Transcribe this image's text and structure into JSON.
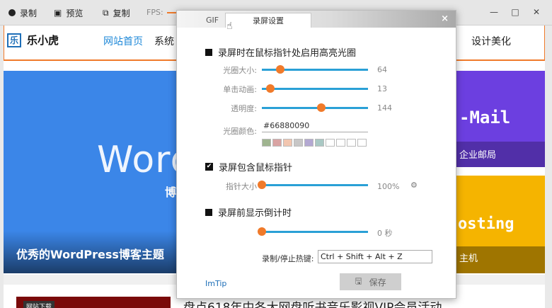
{
  "recorder": {
    "record_label": "录制",
    "preview_label": "预览",
    "copy_label": "复制",
    "fps_label": "FPS:"
  },
  "site": {
    "logo_mark": "乐",
    "logo_text": "乐小虎",
    "nav": [
      "网站首页",
      "系统",
      "设计美化"
    ],
    "hero": {
      "big_text": "Word",
      "sub_text": "博",
      "caption": "优秀的WordPress博客主题"
    },
    "card_purple": {
      "title": "-Mail",
      "subtitle": "企业邮局"
    },
    "card_yellow": {
      "title": "osting",
      "subtitle": "主机"
    },
    "article_tag": "网站下载",
    "article_title": "盘点618年中各大网盘听书音乐影视VIP会员活动"
  },
  "dialog": {
    "tabs": [
      "GIF",
      "录屏设置"
    ],
    "close_label": "×",
    "highlight_option": "录屏时在鼠标指针处启用高亮光圈",
    "highlight_checked": false,
    "sliders_top": [
      {
        "label": "光圈大小:",
        "value": "64",
        "fraction": 0.17
      },
      {
        "label": "单击动画:",
        "value": "13",
        "fraction": 0.08
      },
      {
        "label": "透明度:",
        "value": "144",
        "fraction": 0.56
      }
    ],
    "color_label": "光圈颜色:",
    "color_value": "#66880090",
    "swatch_colors": [
      "#9fb48f",
      "#d9a3a3",
      "#f2c6b0",
      "#c7c6c6",
      "#b3a8d2",
      "#a9c8c4",
      "#ffffff",
      "#ffffff",
      "#ffffff",
      "#ffffff"
    ],
    "include_cursor_option": "录屏包含鼠标指针",
    "include_cursor_checked": true,
    "pointer_size_label": "指针大小",
    "pointer_size_value": "100%",
    "pointer_size_fraction": 0.0,
    "countdown_option": "录屏前显示倒计时",
    "countdown_checked": false,
    "countdown_value": "0 秒",
    "countdown_fraction": 0.0,
    "hotkey_label": "录制/停止热键:",
    "hotkey_value": "Ctrl + Shift + Alt + Z",
    "link_label": "ImTip",
    "save_label": "保存"
  }
}
